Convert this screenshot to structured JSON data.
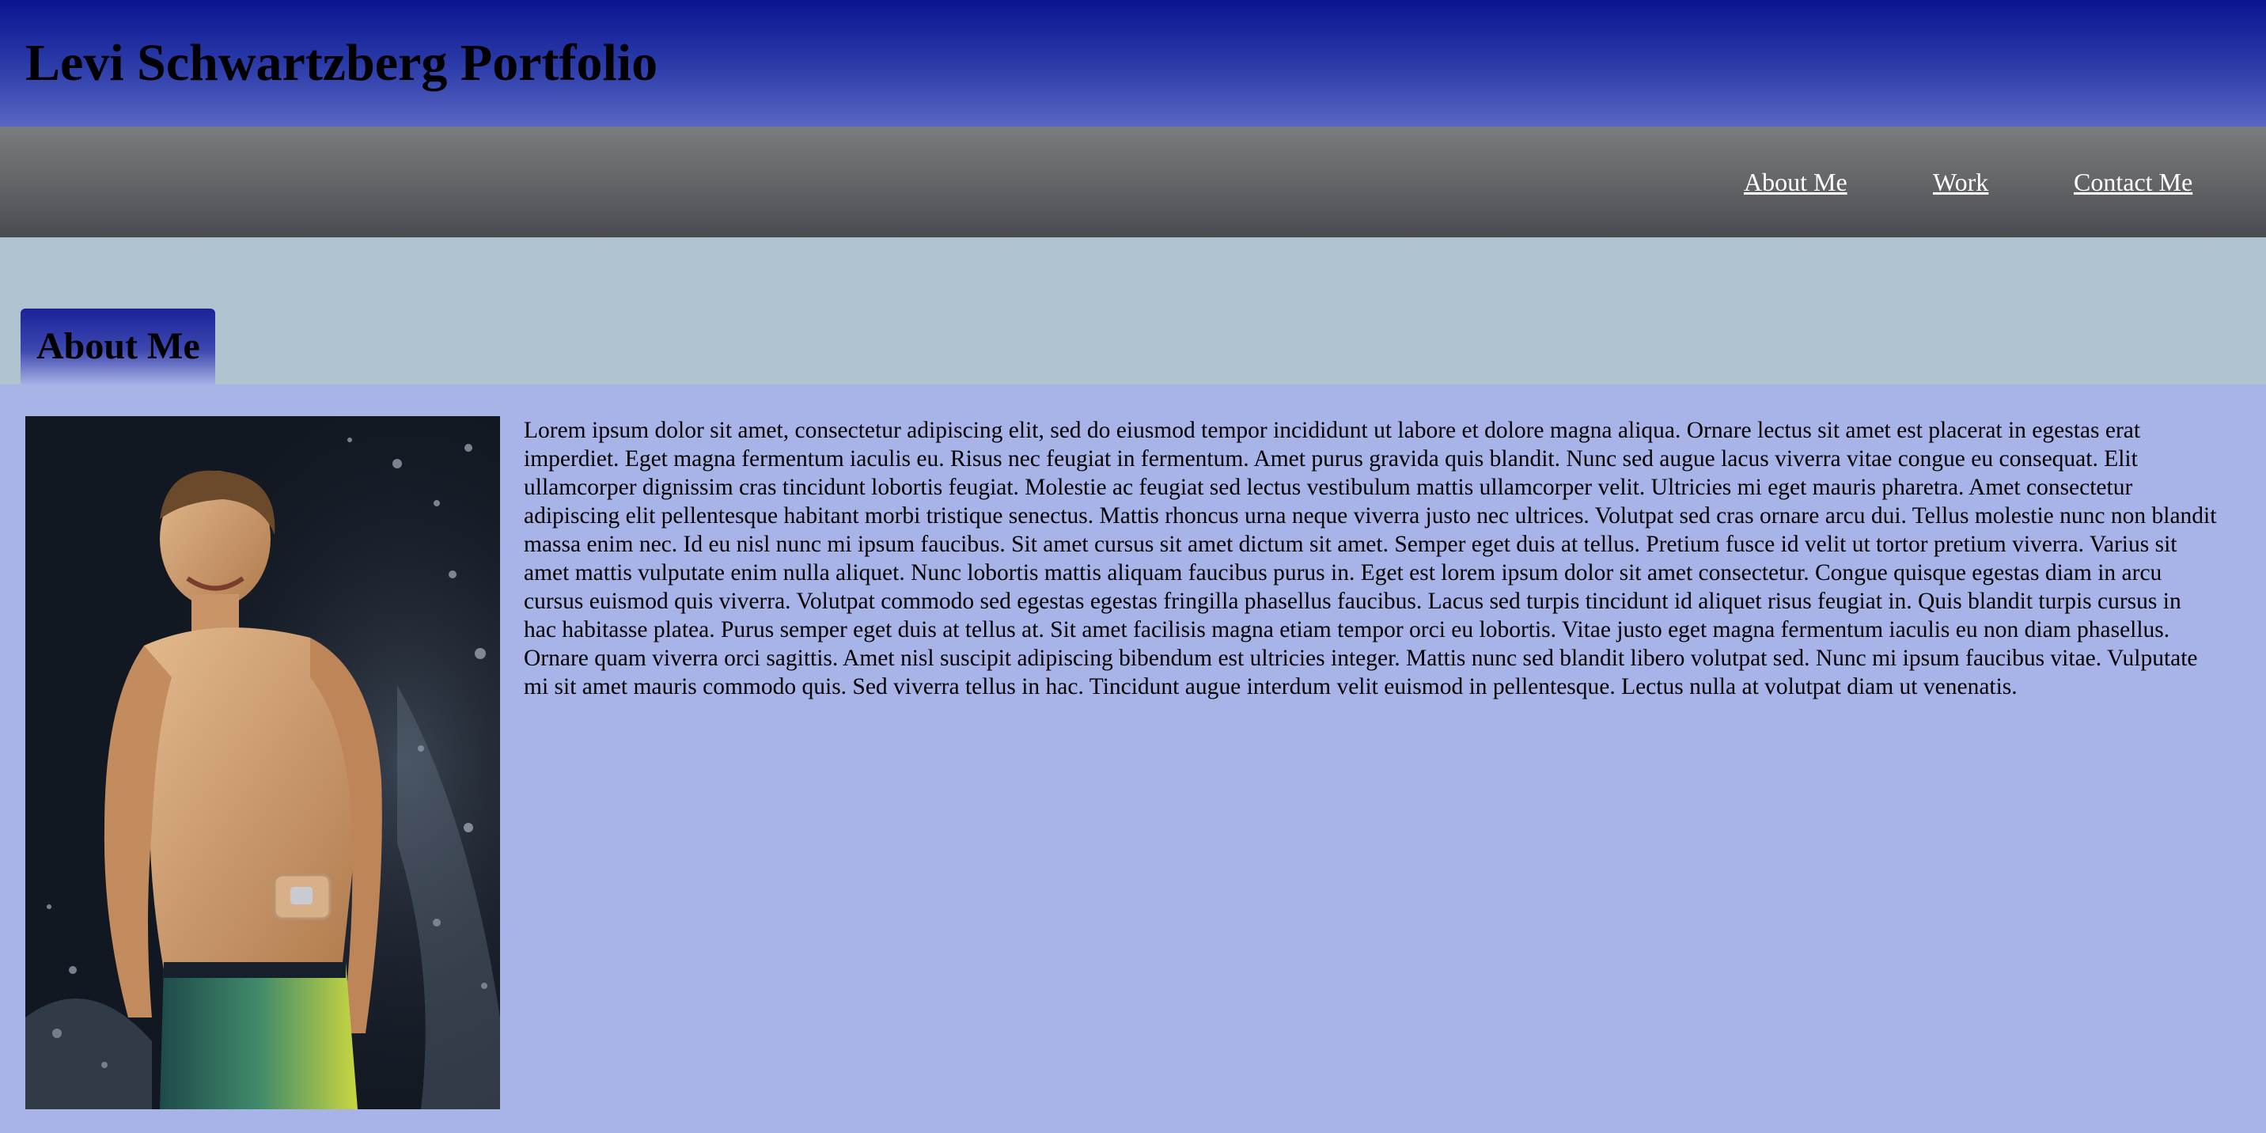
{
  "header": {
    "title": "Levi Schwartzberg Portfolio"
  },
  "nav": {
    "items": [
      {
        "label": "About Me"
      },
      {
        "label": "Work"
      },
      {
        "label": "Contact Me"
      }
    ]
  },
  "about": {
    "heading": "About Me",
    "photo_icon": "portrait-photo",
    "bio": "Lorem ipsum dolor sit amet, consectetur adipiscing elit, sed do eiusmod tempor incididunt ut labore et dolore magna aliqua. Ornare lectus sit amet est placerat in egestas erat imperdiet. Eget magna fermentum iaculis eu. Risus nec feugiat in fermentum. Amet purus gravida quis blandit. Nunc sed augue lacus viverra vitae congue eu consequat. Elit ullamcorper dignissim cras tincidunt lobortis feugiat. Molestie ac feugiat sed lectus vestibulum mattis ullamcorper velit. Ultricies mi eget mauris pharetra. Amet consectetur adipiscing elit pellentesque habitant morbi tristique senectus. Mattis rhoncus urna neque viverra justo nec ultrices. Volutpat sed cras ornare arcu dui. Tellus molestie nunc non blandit massa enim nec. Id eu nisl nunc mi ipsum faucibus. Sit amet cursus sit amet dictum sit amet. Semper eget duis at tellus. Pretium fusce id velit ut tortor pretium viverra. Varius sit amet mattis vulputate enim nulla aliquet. Nunc lobortis mattis aliquam faucibus purus in. Eget est lorem ipsum dolor sit amet consectetur. Congue quisque egestas diam in arcu cursus euismod quis viverra. Volutpat commodo sed egestas egestas fringilla phasellus faucibus. Lacus sed turpis tincidunt id aliquet risus feugiat in. Quis blandit turpis cursus in hac habitasse platea. Purus semper eget duis at tellus at. Sit amet facilisis magna etiam tempor orci eu lobortis. Vitae justo eget magna fermentum iaculis eu non diam phasellus. Ornare quam viverra orci sagittis. Amet nisl suscipit adipiscing bibendum est ultricies integer. Mattis nunc sed blandit libero volutpat sed. Nunc mi ipsum faucibus vitae. Vulputate mi sit amet mauris commodo quis. Sed viverra tellus in hac. Tincidunt augue interdum velit euismod in pellentesque. Lectus nulla at volutpat diam ut venenatis."
  },
  "colors": {
    "header_gradient_top": "#0a1590",
    "header_gradient_bottom": "#5a66c4",
    "nav_bar": "#646569",
    "band": "#afc2d0",
    "content_background": "#a8b4e8",
    "nav_link": "#ffffff"
  }
}
